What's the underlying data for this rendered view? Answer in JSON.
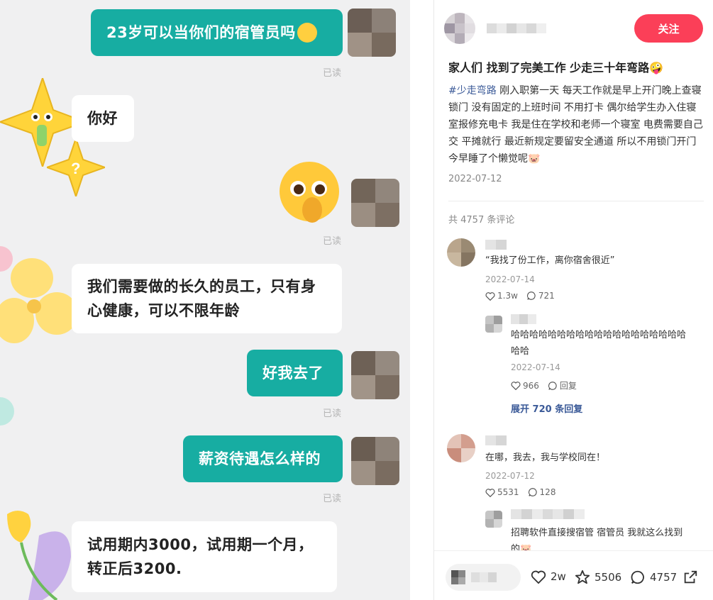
{
  "chat": {
    "messages": [
      {
        "side": "out",
        "text": "23岁可以当你们的宿管员吗"
      },
      {
        "side": "in",
        "text": "你好"
      },
      {
        "side": "out",
        "text": "[emoji]"
      },
      {
        "side": "in",
        "text_line1": "我们需要做的长久的员工，只有身",
        "text_line2": "心健康，可以不限年龄"
      },
      {
        "side": "out",
        "text": "好我去了"
      },
      {
        "side": "out",
        "text": "薪资待遇怎么样的"
      },
      {
        "side": "in",
        "text_line1": "试用期内3000，试用期一个月，",
        "text_line2": "转正后3200."
      }
    ],
    "read_label": "已读"
  },
  "post": {
    "follow_label": "关注",
    "title": "家人们 找到了完美工作 少走三十年弯路🤪",
    "tag": "#少走弯路",
    "body": " 刚入职第一天 每天工作就是早上开门晚上查寝锁门 没有固定的上班时间 不用打卡 偶尔给学生办入住寝室报修充电卡 我是住在学校和老师一个寝室 电费需要自己交 平摊就行 最近新规定要留安全通道 所以不用锁门开门 今早睡了个懒觉呢🐷",
    "date": "2022-07-12",
    "comment_count": "共 4757 条评论"
  },
  "comments": [
    {
      "text": "“我找了份工作，离你宿舍很近”",
      "date": "2022-07-14",
      "likes": "1.3w",
      "replies": "721"
    },
    {
      "text_line1": "哈哈哈哈哈哈哈哈哈哈哈哈哈哈哈哈哈哈哈",
      "text_line2": "哈哈",
      "date": "2022-07-14",
      "likes": "966",
      "reply_label": "回复"
    },
    {
      "text": "在哪，我去，我与学校同在！",
      "date": "2022-07-12",
      "likes": "5531",
      "replies": "128"
    },
    {
      "text_line1": "招聘软件直接搜宿管 宿管员 我就这么找到",
      "text_line2": "的🐷"
    }
  ],
  "expand_label": "展开 720 条回复",
  "bottom_bar": {
    "likes": "2w",
    "stars": "5506",
    "comments": "4757"
  },
  "colors": {
    "bubble_out": "#17ada2",
    "follow": "#fb3f58",
    "link": "#3b5a98"
  }
}
